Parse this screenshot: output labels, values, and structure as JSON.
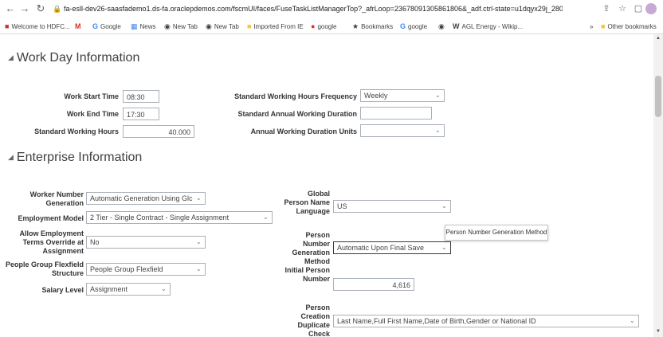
{
  "browser": {
    "url": "fa-esll-dev26-saasfademo1.ds-fa.oraclepdemos.com/fscmUI/faces/FuseTaskListManagerTop?_afrLoop=23678091305861806&_adf.ctrl-state=u1dqyx29j_280",
    "bookmarks": [
      {
        "label": "Welcome to HDFC...",
        "icon": "hdfc-icon"
      },
      {
        "label": "M",
        "icon": "gmail-icon"
      },
      {
        "label": "Google",
        "icon": "google-icon"
      },
      {
        "label": "News",
        "icon": "news-icon"
      },
      {
        "label": "New Tab",
        "icon": "globe-icon"
      },
      {
        "label": "New Tab",
        "icon": "globe-icon"
      },
      {
        "label": "Imported From IE",
        "icon": "folder-icon"
      },
      {
        "label": "google",
        "icon": "red-icon"
      },
      {
        "label": "Bookmarks",
        "icon": "star-icon"
      },
      {
        "label": "google",
        "icon": "google-icon"
      },
      {
        "label": "",
        "icon": "globe-icon"
      },
      {
        "label": "AGL Energy - Wikip...",
        "icon": "wikipedia-icon"
      }
    ],
    "more_bookmarks": "»",
    "other_bookmarks": "Other bookmarks"
  },
  "work_day": {
    "title": "Work Day Information",
    "start_time_label": "Work Start Time",
    "start_time_value": "08:30",
    "end_time_label": "Work End Time",
    "end_time_value": "17:30",
    "std_hours_label": "Standard Working Hours",
    "std_hours_value": "40.000",
    "freq_label": "Standard Working Hours Frequency",
    "freq_value": "Weekly",
    "annual_duration_label": "Standard Annual Working Duration",
    "annual_duration_value": "",
    "annual_units_label": "Annual Working Duration Units",
    "annual_units_value": ""
  },
  "enterprise": {
    "title": "Enterprise Information",
    "worker_number_gen_label": "Worker Number Generation",
    "worker_number_gen_value": "Automatic Generation Using Glc",
    "employment_model_label": "Employment Model",
    "employment_model_value": "2 Tier - Single Contract - Single Assignment",
    "allow_override_label": "Allow Employment Terms Override at Assignment",
    "allow_override_value": "No",
    "people_group_label": "People Group Flexfield Structure",
    "people_group_value": "People Group Flexfield",
    "salary_level_label": "Salary Level",
    "salary_level_value": "Assignment",
    "global_person_name_lang_label": "Global Person Name Language",
    "global_person_name_lang_value": "US",
    "person_number_method_label": "Person Number Generation Method",
    "person_number_method_value": "Automatic Upon Final Save",
    "initial_person_number_label": "Initial Person Number",
    "initial_person_number_value": "4,616",
    "duplicate_check_label": "Person Creation Duplicate Check",
    "duplicate_check_value": "Last Name,Full First Name,Date of Birth,Gender or National ID",
    "tooltip": "Person Number Generation Method"
  }
}
